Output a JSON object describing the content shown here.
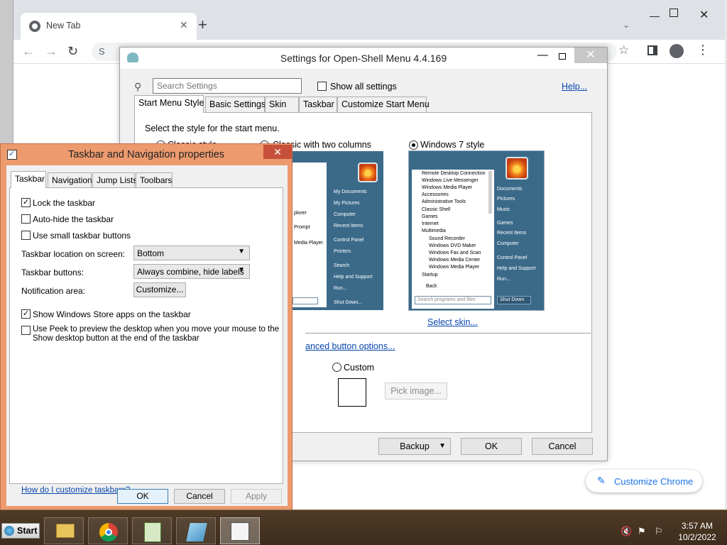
{
  "chrome": {
    "tab_title": "New Tab",
    "omnibox_hint": "S",
    "customize_label": "Customize Chrome"
  },
  "openshell": {
    "title": "Settings for Open-Shell Menu 4.4.169",
    "search_placeholder": "Search Settings",
    "show_all_label": "Show all settings",
    "help_link": "Help...",
    "tabs": [
      "Start Menu Style",
      "Basic Settings",
      "Skin",
      "Taskbar",
      "Customize Start Menu"
    ],
    "prompt": "Select the style for the start menu.",
    "styles": [
      "Classic style",
      "Classic with two columns",
      "Windows 7 style"
    ],
    "selected_style": "Windows 7 style",
    "classic_right_items": [
      "My Documents",
      "My Pictures",
      "Computer",
      "Recent Items",
      "Control Panel",
      "Printers",
      "Search",
      "Help and Support",
      "Run...",
      "Shut Down..."
    ],
    "classic_left_items": [
      "plorer",
      "Prompt",
      "Media Player"
    ],
    "win7_left_items": [
      "Remote Desktop Connection",
      "Windows Live Messenger",
      "Windows Media Player",
      "Accessories",
      "Administrative Tools",
      "Classic Shell",
      "Games",
      "Internet",
      "Multimedia",
      "Sound Recorder",
      "Windows DVD Maker",
      "Windows Fax and Scan",
      "Windows Media Center",
      "Windows Media Player",
      "Startup",
      "Back"
    ],
    "win7_search": "Search programs and files",
    "win7_right_items": [
      "Documents",
      "Pictures",
      "Music",
      "Games",
      "Recent Items",
      "Computer",
      "Control Panel",
      "Help and Support",
      "Run...",
      "Shut Down"
    ],
    "select_skin_link": "Select skin...",
    "advanced_link": "anced button options...",
    "custom_label": "Custom",
    "pick_image_label": "Pick image...",
    "backup_label": "Backup",
    "ok_label": "OK",
    "cancel_label": "Cancel"
  },
  "taskbar_props": {
    "title": "Taskbar and Navigation properties",
    "tabs": [
      "Taskbar",
      "Navigation",
      "Jump Lists",
      "Toolbars"
    ],
    "lock_taskbar": "Lock the taskbar",
    "auto_hide": "Auto-hide the taskbar",
    "small_buttons": "Use small taskbar buttons",
    "location_label": "Taskbar location on screen:",
    "location_value": "Bottom",
    "buttons_label": "Taskbar buttons:",
    "buttons_value": "Always combine, hide labels",
    "notification_label": "Notification area:",
    "customize_button": "Customize...",
    "store_apps": "Show Windows Store apps on the taskbar",
    "peek_line1": "Use Peek to preview the desktop when you move your mouse to the",
    "peek_line2": "Show desktop button at the end of the taskbar",
    "how_link": "How do I customize taskbars?",
    "ok_label": "OK",
    "cancel_label": "Cancel",
    "apply_label": "Apply"
  },
  "taskbar": {
    "start_label": "Start",
    "time": "3:57 AM",
    "date": "10/2/2022"
  }
}
